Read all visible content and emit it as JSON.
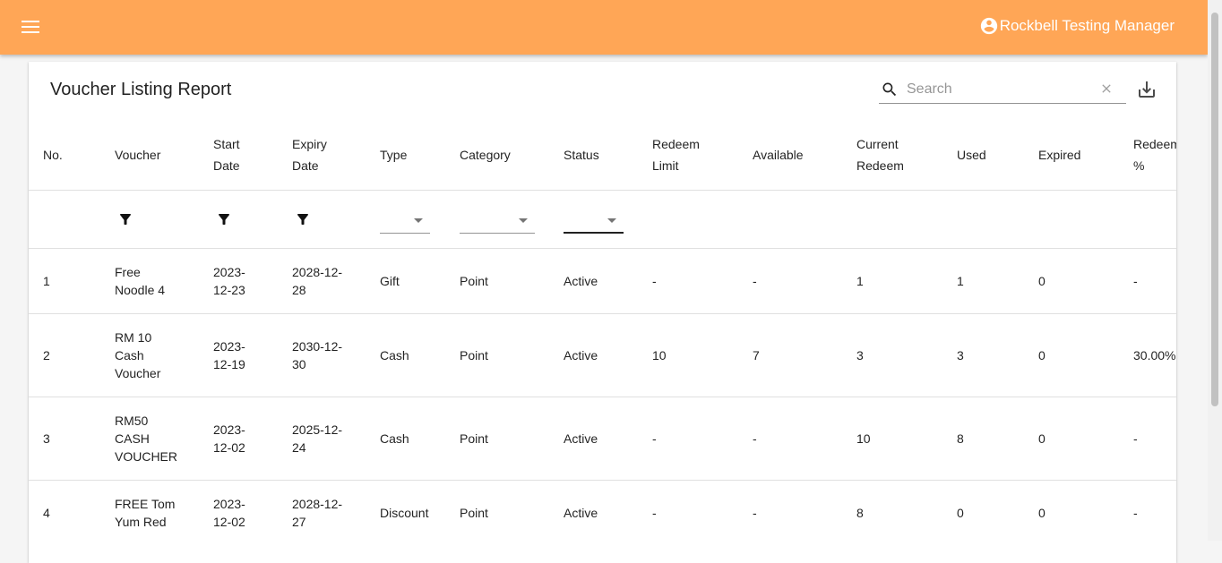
{
  "header": {
    "user_name": "Rockbell Testing Manager"
  },
  "page": {
    "title": "Voucher Listing Report",
    "search_placeholder": "Search"
  },
  "table": {
    "columns": [
      {
        "key": "no",
        "lines": [
          "No."
        ]
      },
      {
        "key": "voucher",
        "lines": [
          "Voucher"
        ]
      },
      {
        "key": "start",
        "lines": [
          "Start",
          "Date"
        ]
      },
      {
        "key": "expiry",
        "lines": [
          "Expiry",
          "Date"
        ]
      },
      {
        "key": "type",
        "lines": [
          "Type"
        ]
      },
      {
        "key": "category",
        "lines": [
          "Category"
        ]
      },
      {
        "key": "status",
        "lines": [
          "Status"
        ]
      },
      {
        "key": "limit",
        "lines": [
          "Redeem",
          "Limit"
        ]
      },
      {
        "key": "available",
        "lines": [
          "Available"
        ]
      },
      {
        "key": "current",
        "lines": [
          "Current",
          "Redeem"
        ]
      },
      {
        "key": "used",
        "lines": [
          "Used"
        ]
      },
      {
        "key": "expired",
        "lines": [
          "Expired"
        ]
      },
      {
        "key": "pct",
        "lines": [
          "Redeem",
          "%"
        ]
      }
    ],
    "rows": [
      {
        "no": [
          "1"
        ],
        "voucher": [
          "Free",
          "Noodle 4"
        ],
        "start": [
          "2023-",
          "12-23"
        ],
        "expiry": [
          "2028-12-",
          "28"
        ],
        "type": [
          "Gift"
        ],
        "category": [
          "Point"
        ],
        "status": [
          "Active"
        ],
        "limit": [
          "-"
        ],
        "available": [
          "-"
        ],
        "current": [
          "1"
        ],
        "used": [
          "1"
        ],
        "expired": [
          "0"
        ],
        "pct": [
          "-"
        ]
      },
      {
        "no": [
          "2"
        ],
        "voucher": [
          "RM 10",
          "Cash",
          "Voucher"
        ],
        "start": [
          "2023-",
          "12-19"
        ],
        "expiry": [
          "2030-12-",
          "30"
        ],
        "type": [
          "Cash"
        ],
        "category": [
          "Point"
        ],
        "status": [
          "Active"
        ],
        "limit": [
          "10"
        ],
        "available": [
          "7"
        ],
        "current": [
          "3"
        ],
        "used": [
          "3"
        ],
        "expired": [
          "0"
        ],
        "pct": [
          "30.00%"
        ]
      },
      {
        "no": [
          "3"
        ],
        "voucher": [
          "RM50",
          "CASH",
          "VOUCHER"
        ],
        "start": [
          "2023-",
          "12-02"
        ],
        "expiry": [
          "2025-12-",
          "24"
        ],
        "type": [
          "Cash"
        ],
        "category": [
          "Point"
        ],
        "status": [
          "Active"
        ],
        "limit": [
          "-"
        ],
        "available": [
          "-"
        ],
        "current": [
          "10"
        ],
        "used": [
          "8"
        ],
        "expired": [
          "0"
        ],
        "pct": [
          "-"
        ]
      },
      {
        "no": [
          "4"
        ],
        "voucher": [
          "FREE Tom",
          "Yum Red"
        ],
        "start": [
          "2023-",
          "12-02"
        ],
        "expiry": [
          "2028-12-",
          "27"
        ],
        "type": [
          "Discount"
        ],
        "category": [
          "Point"
        ],
        "status": [
          "Active"
        ],
        "limit": [
          "-"
        ],
        "available": [
          "-"
        ],
        "current": [
          "8"
        ],
        "used": [
          "0"
        ],
        "expired": [
          "0"
        ],
        "pct": [
          "-"
        ]
      }
    ]
  },
  "icons": {
    "menu": "menu-icon",
    "account": "account-circle-icon",
    "search": "search-icon",
    "clear": "close-icon",
    "download": "download-icon",
    "filter": "filter-icon",
    "caret": "arrow-drop-down-icon"
  },
  "colors": {
    "appbar": "#ffa656",
    "background": "#f5f5f5",
    "card": "#ffffff"
  }
}
